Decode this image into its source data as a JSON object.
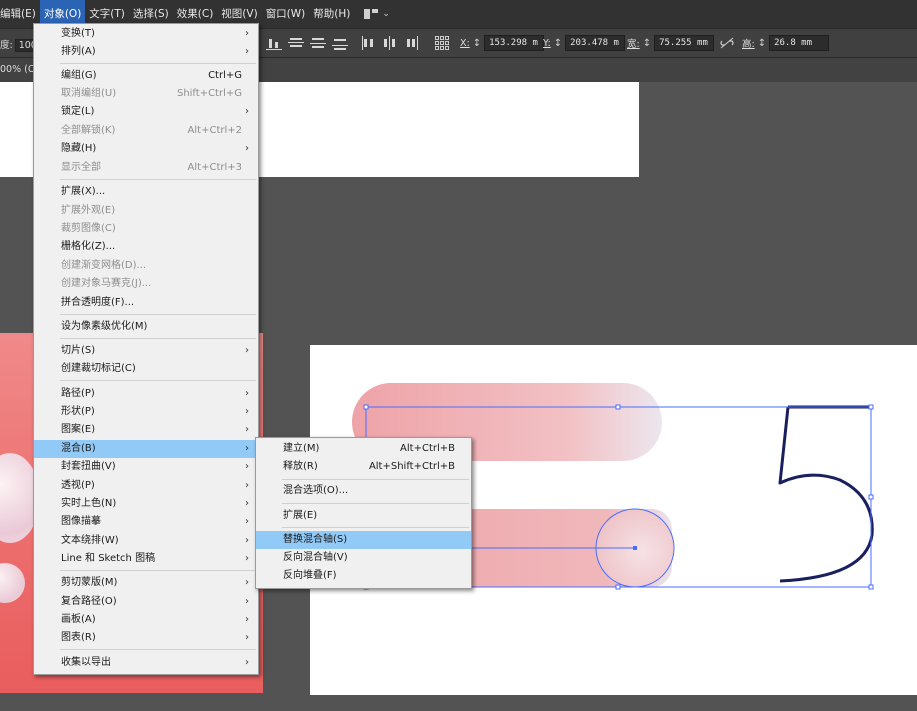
{
  "menubar": {
    "items": [
      "编辑(E)",
      "对象(O)",
      "文字(T)",
      "选择(S)",
      "效果(C)",
      "视图(V)",
      "窗口(W)",
      "帮助(H)"
    ],
    "active_index": 1
  },
  "controlbar": {
    "left_label": "度:",
    "left_value": "100",
    "x_label": "X:",
    "x_value": "153.298 m",
    "y_label": "Y:",
    "y_value": "203.478 m",
    "w_label": "宽:",
    "w_value": "75.255 mm",
    "h_label": "高:",
    "h_value": "26.8 mm"
  },
  "tabbar": {
    "zoom": "00% (C"
  },
  "object_menu": {
    "items": [
      {
        "label": "变换(T)",
        "shortcut": "",
        "submenu": true,
        "disabled": false
      },
      {
        "label": "排列(A)",
        "shortcut": "",
        "submenu": true,
        "disabled": false
      },
      {
        "label": "编组(G)",
        "shortcut": "Ctrl+G",
        "submenu": false,
        "disabled": false
      },
      {
        "label": "取消编组(U)",
        "shortcut": "Shift+Ctrl+G",
        "submenu": false,
        "disabled": true
      },
      {
        "label": "锁定(L)",
        "shortcut": "",
        "submenu": true,
        "disabled": false
      },
      {
        "label": "全部解锁(K)",
        "shortcut": "Alt+Ctrl+2",
        "submenu": false,
        "disabled": true
      },
      {
        "label": "隐藏(H)",
        "shortcut": "",
        "submenu": true,
        "disabled": false
      },
      {
        "label": "显示全部",
        "shortcut": "Alt+Ctrl+3",
        "submenu": false,
        "disabled": true
      },
      {
        "label": "扩展(X)...",
        "shortcut": "",
        "submenu": false,
        "disabled": false
      },
      {
        "label": "扩展外观(E)",
        "shortcut": "",
        "submenu": false,
        "disabled": true
      },
      {
        "label": "裁剪图像(C)",
        "shortcut": "",
        "submenu": false,
        "disabled": true
      },
      {
        "label": "栅格化(Z)...",
        "shortcut": "",
        "submenu": false,
        "disabled": false
      },
      {
        "label": "创建渐变网格(D)...",
        "shortcut": "",
        "submenu": false,
        "disabled": true
      },
      {
        "label": "创建对象马赛克(J)...",
        "shortcut": "",
        "submenu": false,
        "disabled": true
      },
      {
        "label": "拼合透明度(F)...",
        "shortcut": "",
        "submenu": false,
        "disabled": false
      },
      {
        "label": "设为像素级优化(M)",
        "shortcut": "",
        "submenu": false,
        "disabled": false
      },
      {
        "label": "切片(S)",
        "shortcut": "",
        "submenu": true,
        "disabled": false
      },
      {
        "label": "创建裁切标记(C)",
        "shortcut": "",
        "submenu": false,
        "disabled": false
      },
      {
        "label": "路径(P)",
        "shortcut": "",
        "submenu": true,
        "disabled": false
      },
      {
        "label": "形状(P)",
        "shortcut": "",
        "submenu": true,
        "disabled": false
      },
      {
        "label": "图案(E)",
        "shortcut": "",
        "submenu": true,
        "disabled": false
      },
      {
        "label": "混合(B)",
        "shortcut": "",
        "submenu": true,
        "disabled": false
      },
      {
        "label": "封套扭曲(V)",
        "shortcut": "",
        "submenu": true,
        "disabled": false
      },
      {
        "label": "透视(P)",
        "shortcut": "",
        "submenu": true,
        "disabled": false
      },
      {
        "label": "实时上色(N)",
        "shortcut": "",
        "submenu": true,
        "disabled": false
      },
      {
        "label": "图像描摹",
        "shortcut": "",
        "submenu": true,
        "disabled": false
      },
      {
        "label": "文本绕排(W)",
        "shortcut": "",
        "submenu": true,
        "disabled": false
      },
      {
        "label": "Line 和 Sketch 图稿",
        "shortcut": "",
        "submenu": true,
        "disabled": false
      },
      {
        "label": "剪切蒙版(M)",
        "shortcut": "",
        "submenu": true,
        "disabled": false
      },
      {
        "label": "复合路径(O)",
        "shortcut": "",
        "submenu": true,
        "disabled": false
      },
      {
        "label": "画板(A)",
        "shortcut": "",
        "submenu": true,
        "disabled": false
      },
      {
        "label": "图表(R)",
        "shortcut": "",
        "submenu": true,
        "disabled": false
      },
      {
        "label": "收集以导出",
        "shortcut": "",
        "submenu": true,
        "disabled": false
      }
    ],
    "highlighted_label": "混合(B)"
  },
  "blend_submenu": {
    "items": [
      {
        "label": "建立(M)",
        "shortcut": "Alt+Ctrl+B"
      },
      {
        "label": "释放(R)",
        "shortcut": "Alt+Shift+Ctrl+B"
      },
      {
        "label": "混合选项(O)...",
        "shortcut": ""
      },
      {
        "label": "扩展(E)",
        "shortcut": ""
      },
      {
        "label": "替换混合轴(S)",
        "shortcut": ""
      },
      {
        "label": "反向混合轴(V)",
        "shortcut": ""
      },
      {
        "label": "反向堆叠(F)",
        "shortcut": ""
      }
    ],
    "highlighted_label": "替换混合轴(S)"
  },
  "canvas": {
    "glyph": "5",
    "blend_color_start": "#f0b0b4",
    "blend_color_end": "#e8e8ef",
    "selection_color": "#4a6cff"
  }
}
